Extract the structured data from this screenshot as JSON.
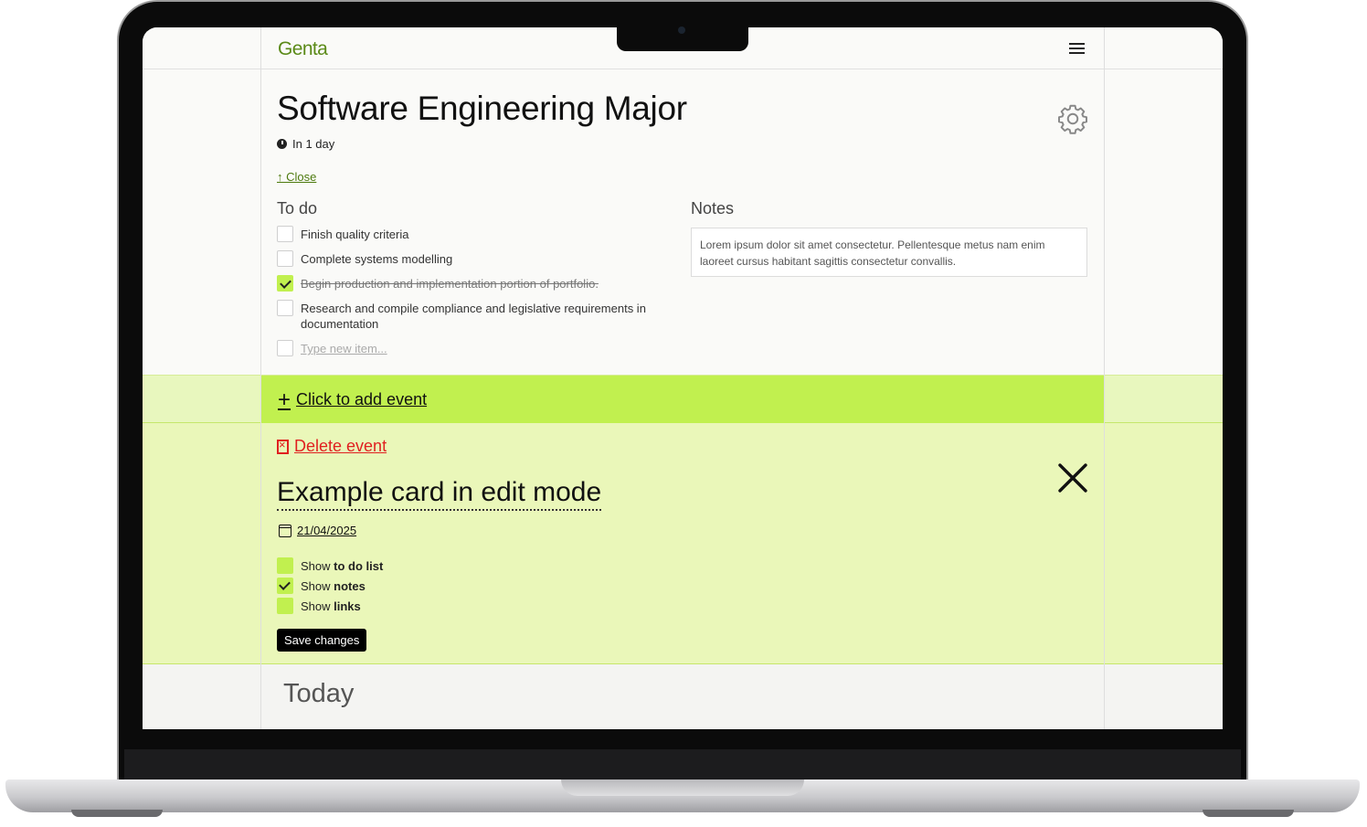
{
  "app": {
    "logo": "Genta"
  },
  "event": {
    "title": "Software Engineering Major",
    "due_text": "In 1 day",
    "close_label": "↑ Close",
    "todo_heading": "To do",
    "notes_heading": "Notes",
    "todos": [
      {
        "text": "Finish quality criteria",
        "done": false
      },
      {
        "text": "Complete systems modelling",
        "done": false
      },
      {
        "text": "Begin production and implementation portion of portfolio.",
        "done": true
      },
      {
        "text": "Research and compile compliance and legislative requirements in documentation",
        "done": false
      }
    ],
    "new_item_placeholder": "Type new item...",
    "notes_text": "Lorem ipsum dolor sit amet consectetur. Pellentesque metus nam enim laoreet cursus habitant sagittis consectetur convallis."
  },
  "add_event": {
    "label": "Click to add event"
  },
  "edit_card": {
    "delete_label": "Delete event",
    "title": "Example card in edit mode",
    "date": "21/04/2025",
    "toggles": [
      {
        "prefix": "Show ",
        "bold": "to do list",
        "checked": false
      },
      {
        "prefix": "Show ",
        "bold": "notes",
        "checked": true
      },
      {
        "prefix": "Show ",
        "bold": "links",
        "checked": false
      }
    ],
    "save_label": "Save changes"
  },
  "today": {
    "label": "Today"
  },
  "colors": {
    "accent": "#c1f04f",
    "accent_light": "#eaf7b9",
    "logo": "#5b8a18",
    "danger": "#e02020"
  }
}
